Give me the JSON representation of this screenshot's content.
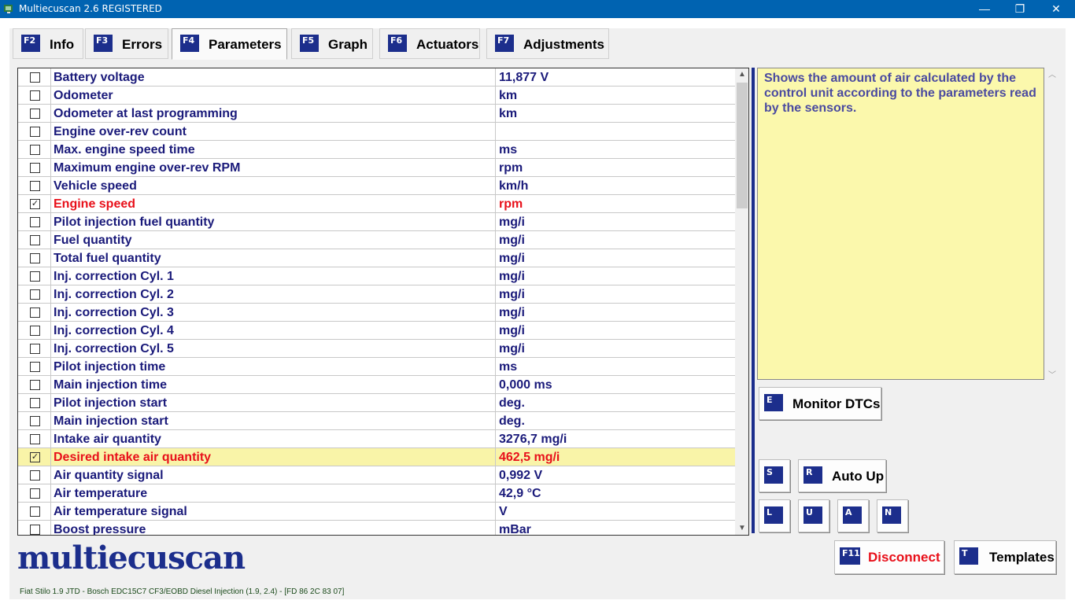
{
  "window": {
    "title": "Multiecuscan 2.6 REGISTERED",
    "minimize": "—",
    "maximize": "❐",
    "close": "✕"
  },
  "tabs": [
    {
      "key": "F2",
      "label": "Info"
    },
    {
      "key": "F3",
      "label": "Errors"
    },
    {
      "key": "F4",
      "label": "Parameters"
    },
    {
      "key": "F5",
      "label": "Graph"
    },
    {
      "key": "F6",
      "label": "Actuators"
    },
    {
      "key": "F7",
      "label": "Adjustments"
    }
  ],
  "active_tab": "Parameters",
  "parameters": [
    {
      "name": "Battery voltage",
      "value": "11,877 V",
      "checked": false
    },
    {
      "name": "Odometer",
      "value": " km",
      "checked": false
    },
    {
      "name": "Odometer at last programming",
      "value": " km",
      "checked": false
    },
    {
      "name": "Engine over-rev count",
      "value": "",
      "checked": false
    },
    {
      "name": "Max. engine speed time",
      "value": " ms",
      "checked": false
    },
    {
      "name": "Maximum engine over-rev RPM",
      "value": " rpm",
      "checked": false
    },
    {
      "name": "Vehicle speed",
      "value": "km/h",
      "checked": false
    },
    {
      "name": "Engine speed",
      "value": " rpm",
      "checked": true
    },
    {
      "name": "Pilot injection fuel quantity",
      "value": " mg/i",
      "checked": false
    },
    {
      "name": "Fuel quantity",
      "value": " mg/i",
      "checked": false
    },
    {
      "name": "Total fuel quantity",
      "value": " mg/i",
      "checked": false
    },
    {
      "name": "Inj. correction Cyl. 1",
      "value": " mg/i",
      "checked": false
    },
    {
      "name": "Inj. correction Cyl. 2",
      "value": " mg/i",
      "checked": false
    },
    {
      "name": "Inj. correction Cyl. 3",
      "value": " mg/i",
      "checked": false
    },
    {
      "name": "Inj. correction Cyl. 4",
      "value": " mg/i",
      "checked": false
    },
    {
      "name": "Inj. correction Cyl. 5",
      "value": " mg/i",
      "checked": false
    },
    {
      "name": "Pilot injection time",
      "value": " ms",
      "checked": false
    },
    {
      "name": "Main injection time",
      "value": "0,000 ms",
      "checked": false
    },
    {
      "name": "Pilot injection start",
      "value": " deg.",
      "checked": false
    },
    {
      "name": "Main injection start",
      "value": " deg.",
      "checked": false
    },
    {
      "name": "Intake air quantity",
      "value": "3276,7 mg/i",
      "checked": false
    },
    {
      "name": "Desired intake air quantity",
      "value": "462,5 mg/i",
      "checked": true,
      "selected": true
    },
    {
      "name": "Air quantity signal",
      "value": "0,992 V",
      "checked": false
    },
    {
      "name": "Air temperature",
      "value": "42,9 °C",
      "checked": false
    },
    {
      "name": "Air temperature signal",
      "value": " V",
      "checked": false
    },
    {
      "name": "Boost pressure",
      "value": " mBar",
      "checked": false
    }
  ],
  "description": "Shows the amount of air calculated by the control unit according to the parameters read by the sensors.",
  "buttons": {
    "monitor_dtcs": {
      "key": "E",
      "label": "Monitor DTCs"
    },
    "s": {
      "key": "S"
    },
    "auto_up": {
      "key": "R",
      "label": "Auto Up"
    },
    "l": {
      "key": "L"
    },
    "u": {
      "key": "U"
    },
    "a": {
      "key": "A"
    },
    "n": {
      "key": "N"
    },
    "disconnect": {
      "key": "F11",
      "label": "Disconnect"
    },
    "templates": {
      "key": "T",
      "label": "Templates"
    }
  },
  "logo": "multiecuscan",
  "status": "Fiat Stilo 1.9 JTD - Bosch EDC15C7 CF3/EOBD Diesel Injection (1.9, 2.4) - [FD 86 2C 83 07]",
  "colors": {
    "titlebar": "#0063b1",
    "key_badge": "#1c2e8c",
    "highlight_text": "#e8101a",
    "param_text": "#1a1a7a",
    "selected_row": "#f9f4a8",
    "description_bg": "#fbf8ac"
  }
}
